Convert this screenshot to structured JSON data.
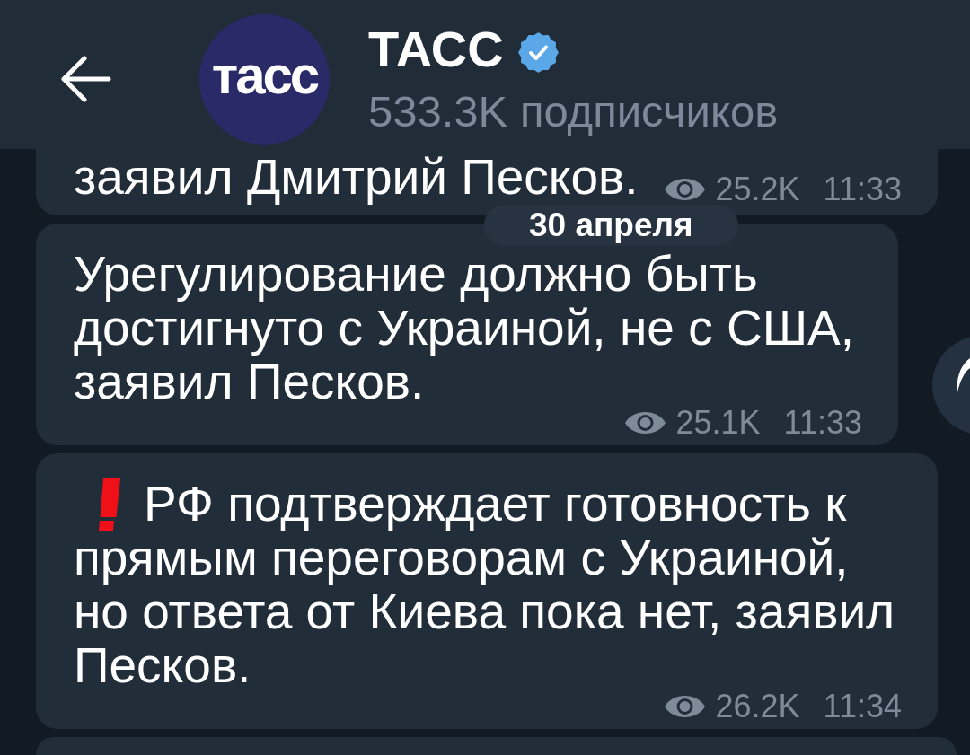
{
  "header": {
    "channel": {
      "avatar_text": "тасс",
      "name": "ТАСС",
      "verified": true,
      "subscribers": "533.3K подписчиков"
    }
  },
  "messages": [
    {
      "kind": "message",
      "text": "заявил Дмитрий Песков.",
      "urgent": false,
      "share_button": false,
      "views": "25.2K",
      "time": "11:33"
    },
    {
      "kind": "date",
      "text": "30 апреля"
    },
    {
      "kind": "message",
      "text": "Урегулирование должно быть достигнуто с Украиной, не с США, заявил Песков.",
      "urgent": false,
      "share_button": true,
      "views": "25.1K",
      "time": "11:33"
    },
    {
      "kind": "message",
      "text": "РФ подтверждает готовность к прямым переговорам с Украиной, но ответа от Киева пока нет, заявил Песков.",
      "urgent": true,
      "share_button": false,
      "views": "26.2K",
      "time": "11:34"
    },
    {
      "kind": "cut_off"
    }
  ]
}
